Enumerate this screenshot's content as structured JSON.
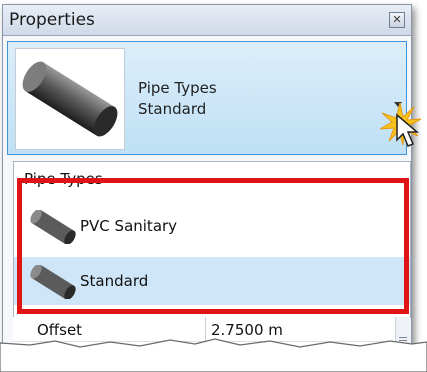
{
  "window": {
    "title": "Properties",
    "close_glyph": "✕"
  },
  "type_selector": {
    "family": "Pipe Types",
    "type": "Standard",
    "thumbnail_icon": "pipe-icon",
    "accent_color": "#3f93d6"
  },
  "list": {
    "header": "Pipe Types",
    "items": [
      {
        "label": "PVC Sanitary",
        "icon": "pipe-icon",
        "selected": false
      },
      {
        "label": "Standard",
        "icon": "pipe-icon",
        "selected": true
      }
    ],
    "highlight_color": "#e01414"
  },
  "properties": {
    "rows": [
      {
        "name": "Offset",
        "value": "2.7500 m"
      }
    ]
  }
}
